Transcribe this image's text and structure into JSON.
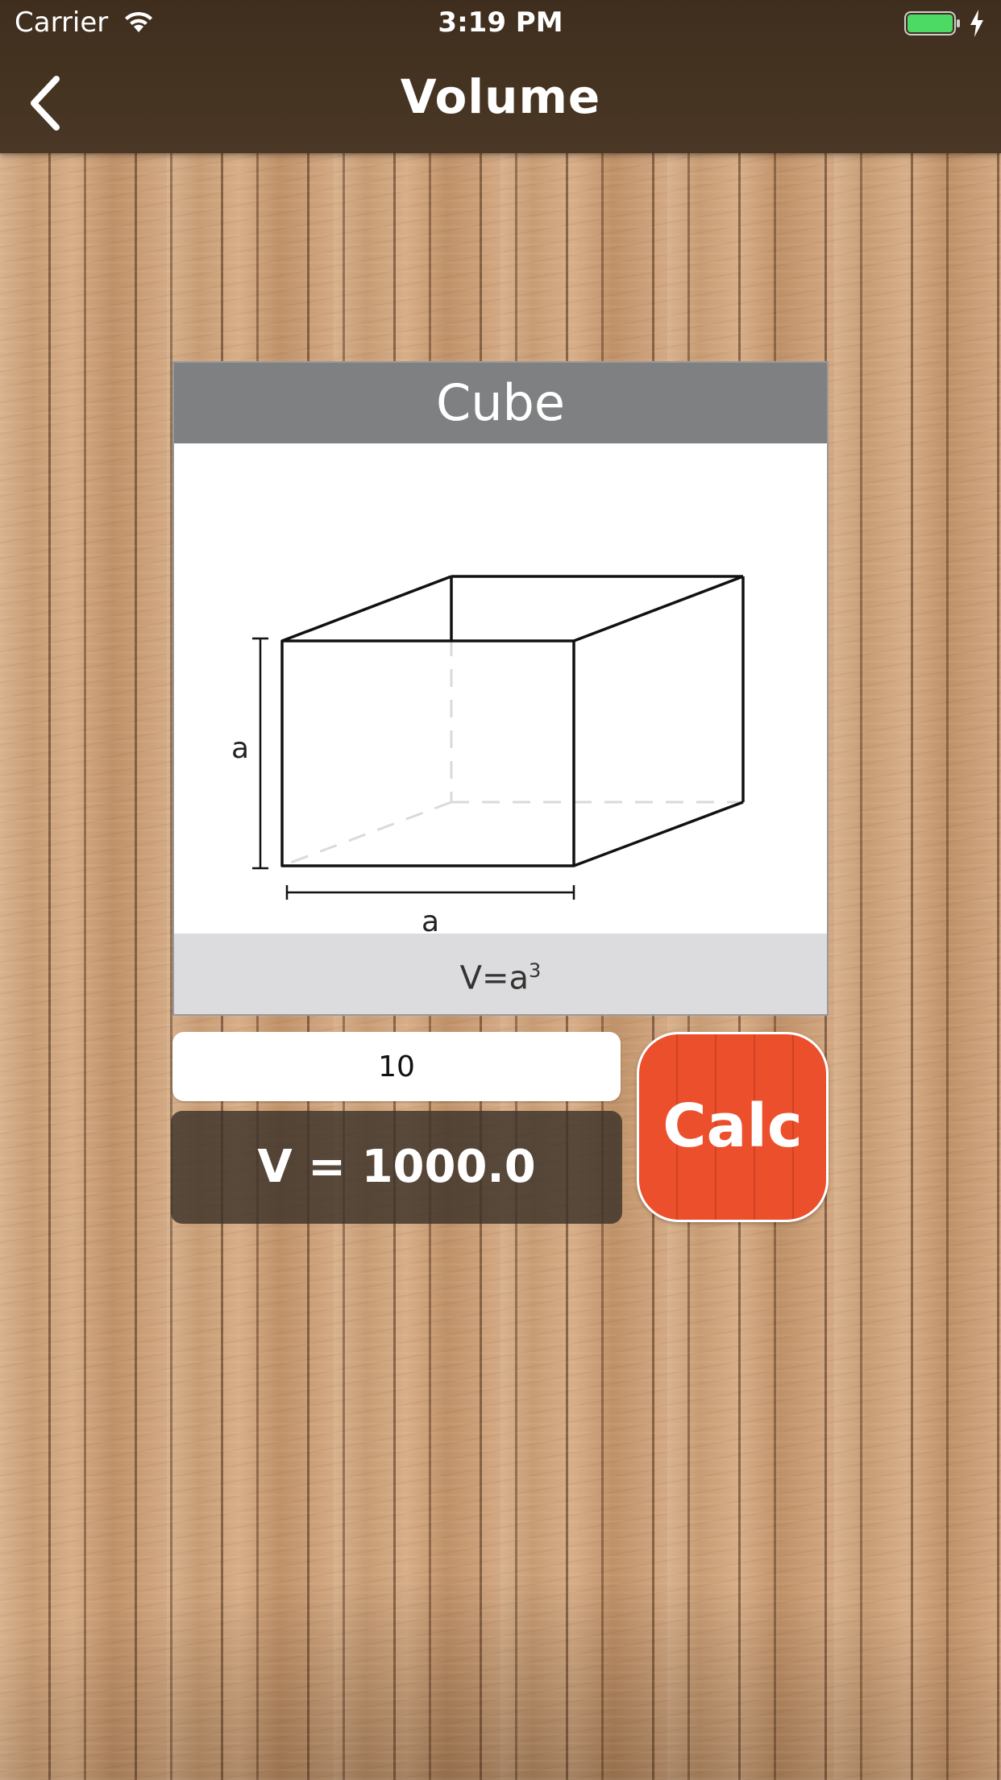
{
  "status_bar": {
    "carrier": "Carrier",
    "time": "3:19 PM",
    "wifi_icon": "wifi-icon",
    "battery_icon": "battery-charging-icon",
    "battery_color": "#4cd964"
  },
  "nav": {
    "title": "Volume",
    "back_icon": "chevron-left-icon",
    "background": "#3f2e1e"
  },
  "shape_card": {
    "title": "Cube",
    "edge_label_height": "a",
    "edge_label_width": "a",
    "formula": "V=a",
    "formula_exponent": "3",
    "header_color": "#7e8081",
    "footer_color": "#dcdcde"
  },
  "input": {
    "value": "10"
  },
  "result": {
    "text": "V = 1000.0"
  },
  "calc_button": {
    "label": "Calc",
    "color": "#ec4f2c"
  }
}
